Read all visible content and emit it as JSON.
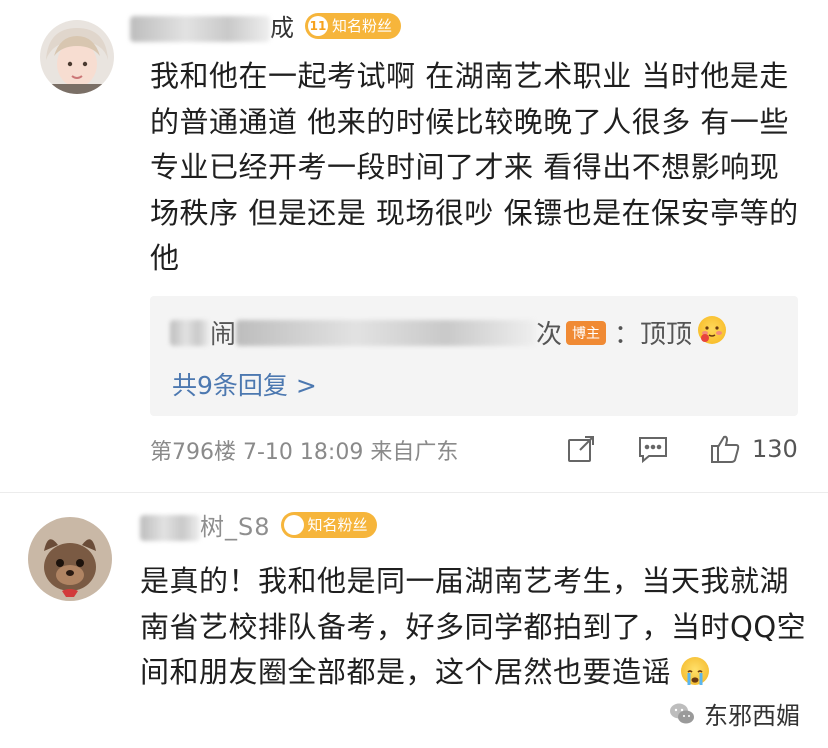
{
  "comments": [
    {
      "name_visible": "成",
      "fan_badge": {
        "level": "11",
        "label": "知名粉丝"
      },
      "text": "我和他在一起考试啊 在湖南艺术职业 当时他是走的普通通道 他来的时候比较晚晚了人很多 有一些专业已经开考一段时间了才来 看得出不想影响现场秩序 但是还是 现场很吵 保镖也是在保安亭等的他",
      "reply_preview": {
        "author_visible": "闹",
        "author_tail": "次",
        "badge": "博主",
        "text": "：顶顶"
      },
      "reply_count": "共9条回复 >",
      "floor": "第796楼",
      "time": "7-10 18:09",
      "source": "来自广东",
      "likes": "130"
    },
    {
      "name_visible": "树_S8",
      "fan_badge": {
        "level": "",
        "label": "知名粉丝"
      },
      "text": "是真的！我和他是同一届湖南艺考生，当天我就湖南省艺校排队备考，好多同学都拍到了，当时QQ空间和朋友圈全部都是，这个居然也要造谣"
    }
  ],
  "watermark": "东邪西媚",
  "colors": {
    "fan_badge": "#f6b53b",
    "link": "#4c78b0",
    "blogger_badge": "#f08a34",
    "meta": "#8a8a8a"
  }
}
